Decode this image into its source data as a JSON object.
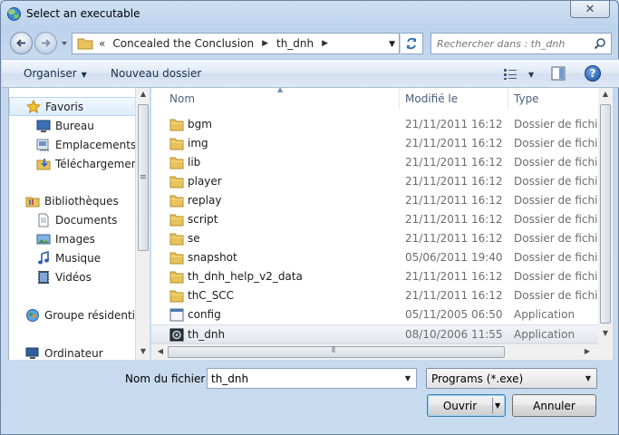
{
  "window": {
    "title": "Select an executable"
  },
  "address": {
    "chevrons": "«",
    "segments": [
      "Concealed the Conclusion",
      "th_dnh"
    ],
    "separator": "▶"
  },
  "search": {
    "placeholder": "Rechercher dans : th_dnh"
  },
  "toolbar": {
    "organise_label": "Organiser",
    "new_folder_label": "Nouveau dossier",
    "help_label": "?"
  },
  "sidebar": {
    "items": [
      {
        "label": "Favoris",
        "icon": "star-icon",
        "level": "group",
        "selected": true
      },
      {
        "label": "Bureau",
        "icon": "desktop-icon",
        "level": "child"
      },
      {
        "label": "Emplacements ré",
        "icon": "recent-places-icon",
        "level": "child"
      },
      {
        "label": "Téléchargements",
        "icon": "downloads-icon",
        "level": "child"
      },
      {
        "label": "Bibliothèques",
        "icon": "libraries-icon",
        "level": "group"
      },
      {
        "label": "Documents",
        "icon": "documents-icon",
        "level": "child"
      },
      {
        "label": "Images",
        "icon": "images-icon",
        "level": "child"
      },
      {
        "label": "Musique",
        "icon": "music-icon",
        "level": "child"
      },
      {
        "label": "Vidéos",
        "icon": "videos-icon",
        "level": "child"
      },
      {
        "label": "Groupe résidentiel",
        "icon": "homegroup-icon",
        "level": "group"
      },
      {
        "label": "Ordinateur",
        "icon": "computer-icon",
        "level": "group"
      }
    ]
  },
  "file_list": {
    "columns": {
      "name": "Nom",
      "modified": "Modifié le",
      "type": "Type"
    },
    "rows": [
      {
        "name": "bgm",
        "modified": "21/11/2011 16:12",
        "type": "Dossier de fichiers",
        "icon": "folder-icon"
      },
      {
        "name": "img",
        "modified": "21/11/2011 16:12",
        "type": "Dossier de fichiers",
        "icon": "folder-icon"
      },
      {
        "name": "lib",
        "modified": "21/11/2011 16:12",
        "type": "Dossier de fichiers",
        "icon": "folder-icon"
      },
      {
        "name": "player",
        "modified": "21/11/2011 16:12",
        "type": "Dossier de fichiers",
        "icon": "folder-icon"
      },
      {
        "name": "replay",
        "modified": "21/11/2011 16:12",
        "type": "Dossier de fichiers",
        "icon": "folder-icon"
      },
      {
        "name": "script",
        "modified": "21/11/2011 16:12",
        "type": "Dossier de fichiers",
        "icon": "folder-icon"
      },
      {
        "name": "se",
        "modified": "21/11/2011 16:12",
        "type": "Dossier de fichiers",
        "icon": "folder-icon"
      },
      {
        "name": "snapshot",
        "modified": "05/06/2011 19:40",
        "type": "Dossier de fichiers",
        "icon": "folder-icon"
      },
      {
        "name": "th_dnh_help_v2_data",
        "modified": "21/11/2011 16:12",
        "type": "Dossier de fichiers",
        "icon": "folder-icon"
      },
      {
        "name": "thC_SCC",
        "modified": "21/11/2011 16:12",
        "type": "Dossier de fichiers",
        "icon": "folder-icon"
      },
      {
        "name": "config",
        "modified": "05/11/2005 06:50",
        "type": "Application",
        "icon": "config-app-icon"
      },
      {
        "name": "th_dnh",
        "modified": "08/10/2006 11:55",
        "type": "Application",
        "icon": "th-dnh-app-icon",
        "selected": true
      }
    ]
  },
  "footer": {
    "filename_label": "Nom du fichier :",
    "filename_value": "th_dnh",
    "filter_value": "Programs (*.exe)",
    "open_label": "Ouvrir",
    "cancel_label": "Annuler"
  },
  "colors": {
    "accent": "#3c7fb1",
    "folder": "#e8c25a",
    "selection": "#dcebfc"
  }
}
